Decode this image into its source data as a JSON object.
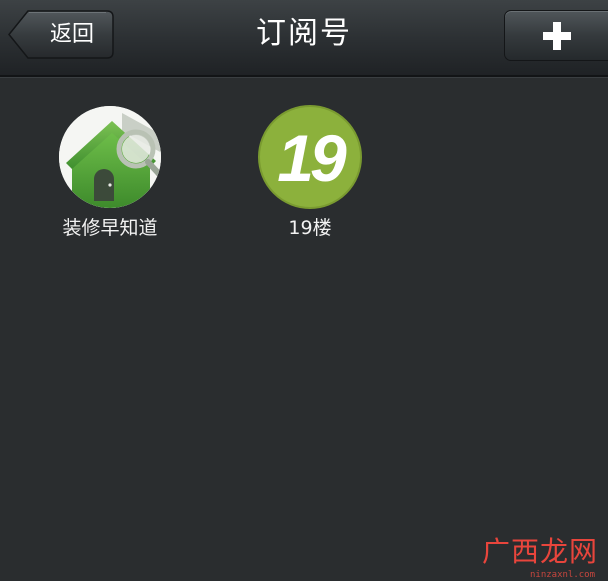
{
  "header": {
    "back_label": "返回",
    "title": "订阅号",
    "add_icon": "plus-icon"
  },
  "accounts": [
    {
      "name": "装修早知道",
      "icon": "house-icon"
    },
    {
      "name": "19楼",
      "icon": "19lou-logo-icon",
      "logo_text": "19"
    }
  ],
  "watermark": {
    "brand": "广西龙网",
    "url": "ninzaxnl.com"
  },
  "colors": {
    "background": "#2a2d2f",
    "header": "#2b2f32",
    "logo_green": "#8cb13c",
    "house_green": "#4e9f3a",
    "watermark_red": "#e8453c"
  }
}
